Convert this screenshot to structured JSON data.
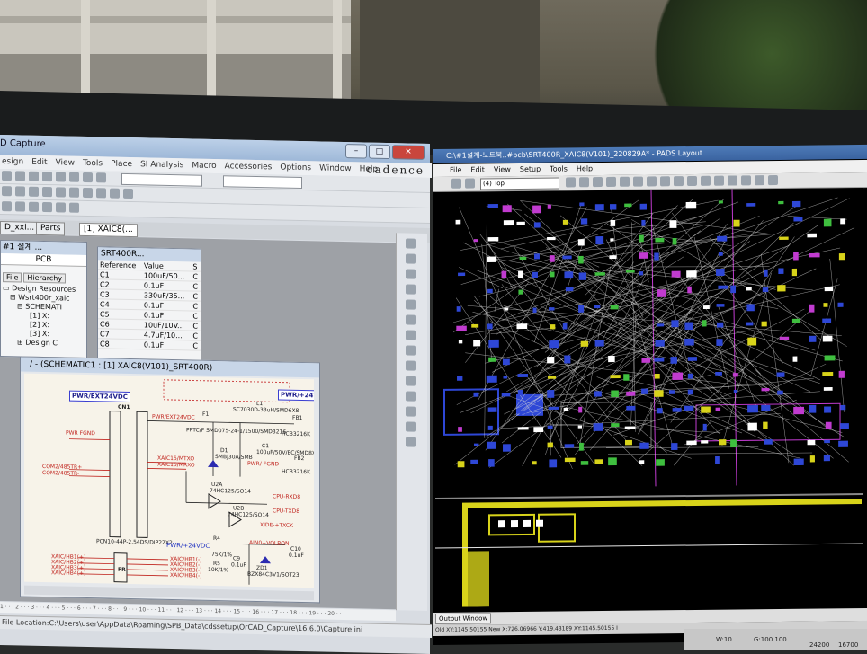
{
  "orcad": {
    "title": "D Capture",
    "menu": [
      "esign",
      "Edit",
      "View",
      "Tools",
      "Place",
      "SI Analysis",
      "Macro",
      "Accessories",
      "Options",
      "Window",
      "Help"
    ],
    "brand": "cadence",
    "tabs": [
      "D_xxi...",
      "Parts",
      "[1] XAIC8(..."
    ],
    "project": {
      "title": "#1 설계 ...",
      "subtitle": "PCB",
      "tabs": [
        "File",
        "Hierarchy"
      ],
      "tree": [
        "Design Resources",
        "Wsrt400r_xaic",
        "SCHEMATI",
        "[1] X:",
        "[2] X:",
        "[3] X:",
        "Design C"
      ]
    },
    "properties": {
      "title": "SRT400R...",
      "headers": [
        "Reference",
        "Value",
        "S"
      ],
      "rows": [
        [
          "C1",
          "100uF/50...",
          "C"
        ],
        [
          "C2",
          "0.1uF",
          "C"
        ],
        [
          "C3",
          "330uF/35...",
          "C"
        ],
        [
          "C4",
          "0.1uF",
          "C"
        ],
        [
          "C5",
          "0.1uF",
          "C"
        ],
        [
          "C6",
          "10uF/10V...",
          "C"
        ],
        [
          "C7",
          "4.7uF/10...",
          "C"
        ],
        [
          "C8",
          "0.1uF",
          "C"
        ]
      ]
    },
    "schematic": {
      "title": "/ - (SCHEMATIC1 : [1] XAIC8(V101)_SRT400R)",
      "labels": {
        "pwr_in": "PWR/EXT24VDC",
        "pwr_out": "PWR/+24V",
        "cn1": "CN1",
        "f1": "F1",
        "l1": "L1",
        "l1_part": "SC7030D-33uH/SMD6X8",
        "fb1": "FB1",
        "fb1_part": "HCB3216K",
        "fb2": "FB2",
        "fb2_part": "HCB3216K",
        "d1": "D1",
        "d1_part": "SMBJ30A/SMB",
        "c1": "C1",
        "c1_part": "100uF/50V/EC/SMD8X",
        "ptc": "PPTC/F SMD075-24-1/1500/SMD3216",
        "pwr_fgnd": "PWR FGND",
        "pwr_fgnd2": "PWR/-FGND",
        "pwr_ext": "PWR/EXT24VDC",
        "com1": "COM2/485TR+",
        "com2": "COM2/485TR-",
        "xaic_mtxo": "XAIC15/MTXO",
        "xaic_mrxo": "XAIC15/MRXO",
        "u2a": "U2A",
        "u2a_part": "74HC125/SO14",
        "u2b": "U2B",
        "u2b_part": "74HC125/SO14",
        "cpu_rxd": "CPU-RXD8",
        "cpu_txd": "CPU-TXD8",
        "xide": "XIDE-+TXCK",
        "connector": "PCN10-44P-2.54DS/DIP22X2",
        "pwr24": "PWR/+24VDC",
        "r4": "R4",
        "r4_val": "75K/1%",
        "r5": "R5",
        "r5_val": "10K/1%",
        "c9": "C9",
        "c9_val": "0.1uF",
        "ain": "AIN0+VOLBON",
        "c10": "C10",
        "c10_val": "0.1uF",
        "zd1": "ZD1",
        "zd1_part": "BZX84C3V1/SOT23",
        "fr": "FR",
        "nets_left": [
          "XAIC/HB1(+)",
          "XAIC/HB2(+)",
          "XAIC/HB3(+)",
          "XAIC/HB4(+)"
        ],
        "nets_right": [
          "XAIC/HB1(-)",
          "XAIC/HB2(-)",
          "XAIC/HB3(-)",
          "XAIC/HB4(-)"
        ]
      }
    },
    "ruler": "1 · · · 2 · · · 3 · · · 4 · · · 5 · · · 6 · · · 7 · · · 8 · · · 9 · · · 10 · · · 11 · · · 12 · · · 13 · · · 14 · · · 15 · · · 16 · · · 17 · · · 18 · · · 19 · · · 20 · ·",
    "status": "File Location:C:\\Users\\user\\AppData\\Roaming\\SPB_Data\\cdssetup\\OrCAD_Capture\\16.6.0\\Capture.ini"
  },
  "pads": {
    "title": "C:\\#1설계-노트북..#pcb\\SRT400R_XAIC8(V101)_220829A* - PADS Layout",
    "menu": [
      "File",
      "Edit",
      "View",
      "Setup",
      "Tools",
      "Help"
    ],
    "layer": "(4) Top",
    "output_button": "Output Window",
    "status": "Old XY:1145.50155 New X:726.06966 Y:419.43189 XY:1145.50155 I",
    "taskbar": [
      "W:10",
      "G:100 100",
      "24200",
      "16700"
    ]
  },
  "colors": {
    "schematic_bg": "#f7f3e9",
    "net_red": "#c0241e",
    "pads_bg": "#000000",
    "pads_yellow": "#d8d31a",
    "pads_blue": "#2e47d6",
    "pads_magenta": "#c13bd0"
  }
}
